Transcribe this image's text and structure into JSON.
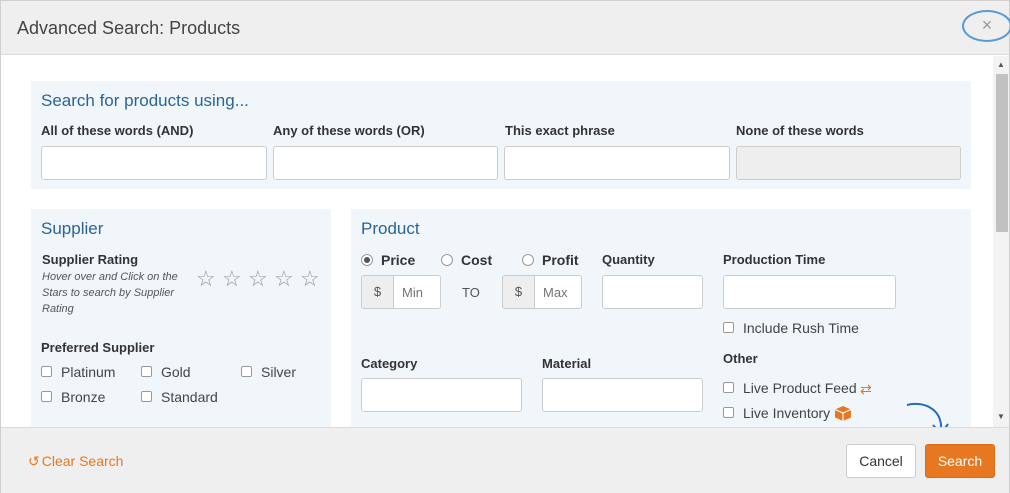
{
  "header": {
    "title": "Advanced Search: Products",
    "close_label": "×"
  },
  "keywords": {
    "title": "Search for products using...",
    "fields": [
      {
        "label": "All of these words (AND)",
        "value": ""
      },
      {
        "label": "Any of these words (OR)",
        "value": ""
      },
      {
        "label": "This exact phrase",
        "value": ""
      },
      {
        "label": "None of these words",
        "value": ""
      }
    ]
  },
  "supplier": {
    "title": "Supplier",
    "rating_label": "Supplier Rating",
    "rating_hint": "Hover over and Click on the Stars to search by Supplier Rating",
    "star_glyph": "☆",
    "preferred_label": "Preferred Supplier",
    "options": [
      "Platinum",
      "Gold",
      "Silver",
      "Bronze",
      "Standard"
    ]
  },
  "product": {
    "title": "Product",
    "price_types": [
      "Price",
      "Cost",
      "Profit"
    ],
    "selected_price_type": "Price",
    "currency_symbol": "$",
    "min_placeholder": "Min",
    "max_placeholder": "Max",
    "to_label": "TO",
    "quantity_label": "Quantity",
    "production_time_label": "Production Time",
    "include_rush_label": "Include Rush Time",
    "category_label": "Category",
    "material_label": "Material",
    "other_label": "Other",
    "other_options": [
      "Live Product Feed",
      "Live Inventory"
    ]
  },
  "footer": {
    "clear_label": "Clear Search",
    "cancel_label": "Cancel",
    "search_label": "Search"
  },
  "colors": {
    "accent": "#e87722",
    "heading": "#2a6496",
    "panel_bg": "#f1f6fb"
  },
  "icons": {
    "close": "×",
    "clear": "↺",
    "feed": "⇄",
    "inventory": "box-icon"
  }
}
